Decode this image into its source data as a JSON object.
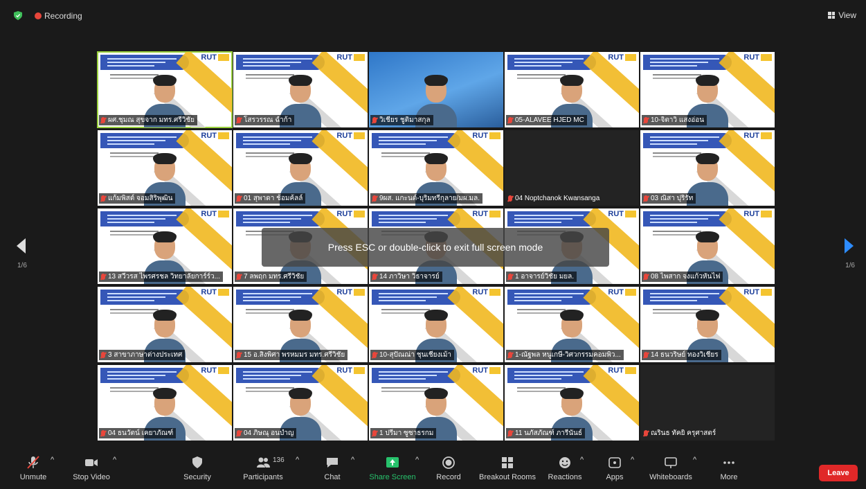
{
  "topbar": {
    "recording_label": "Recording",
    "view_label": "View"
  },
  "overlay": {
    "message": "Press ESC or double-click to exit full screen mode"
  },
  "pagination": {
    "left": "1/6",
    "right": "1/6"
  },
  "participants": [
    {
      "name": "ผศ.ชุมณ สุขจาก มทร.ศรีวิชัย"
    },
    {
      "name": "โสรวรรณ ฉำก้า"
    },
    {
      "name": "วิเชียร ชูติมาสกุล"
    },
    {
      "name": "05-ALAVEE HJED MC"
    },
    {
      "name": "10-จิตาวิ แสงอ่อน"
    },
    {
      "name": "แก้มพิสต์ จอมสิริพุฒิน"
    },
    {
      "name": "01 สุพาดา ช้อมค้ลล์"
    },
    {
      "name": "9ผส. แกะนต์-บุริมทรีกุลาย/มผ.มล."
    },
    {
      "name": "04 Noptchanok Kwansanga"
    },
    {
      "name": "03 ณิสา ปุริรัท"
    },
    {
      "name": "13 สวีวรส ไพรศรชล วิทยาลัยการ์ร์ว..."
    },
    {
      "name": "7 ลพฤก มทร.ศรีวิชัย"
    },
    {
      "name": "14 ภาวิษา วิธาจารย์"
    },
    {
      "name": "1 อาจารย์วิชัย มยล."
    },
    {
      "name": "08 ไพสาก จงแก้วหันไฟ"
    },
    {
      "name": "3 สาขาภาษาต่างประเทศ"
    },
    {
      "name": "15 อ.สิงพิศา พรหมมร มทร.ศรีวิชัย"
    },
    {
      "name": "10-สุปัณณ่า ชุนเชียงเม้า"
    },
    {
      "name": "1-ณัฐพล หนูเกษี-วิศวกรรมคอมพิว..."
    },
    {
      "name": "14 ธนวริษย์ ทองวิเชียร"
    },
    {
      "name": "04 ธนวัตน์ เคยาภัณฑ์"
    },
    {
      "name": "04 ภิษณุ อนบำญ"
    },
    {
      "name": "1 ปรีมา ซูซาธรกม"
    },
    {
      "name": "11 นภัสภัณฑ์ ภารีนันธ์"
    },
    {
      "name": "ณรินธ ทัคยิ ครุศาสตร์"
    }
  ],
  "slide": {
    "logo": "RUT"
  },
  "toolbar": {
    "unmute": "Unmute",
    "stop_video": "Stop Video",
    "security": "Security",
    "participants": "Participants",
    "participant_count": "136",
    "chat": "Chat",
    "share_screen": "Share Screen",
    "record": "Record",
    "breakout": "Breakout Rooms",
    "reactions": "Reactions",
    "apps": "Apps",
    "whiteboards": "Whiteboards",
    "more": "More",
    "leave": "Leave"
  },
  "colors": {
    "accent_green": "#27c26c",
    "leave_red": "#e02828",
    "speaker_border": "#9ad13d"
  }
}
